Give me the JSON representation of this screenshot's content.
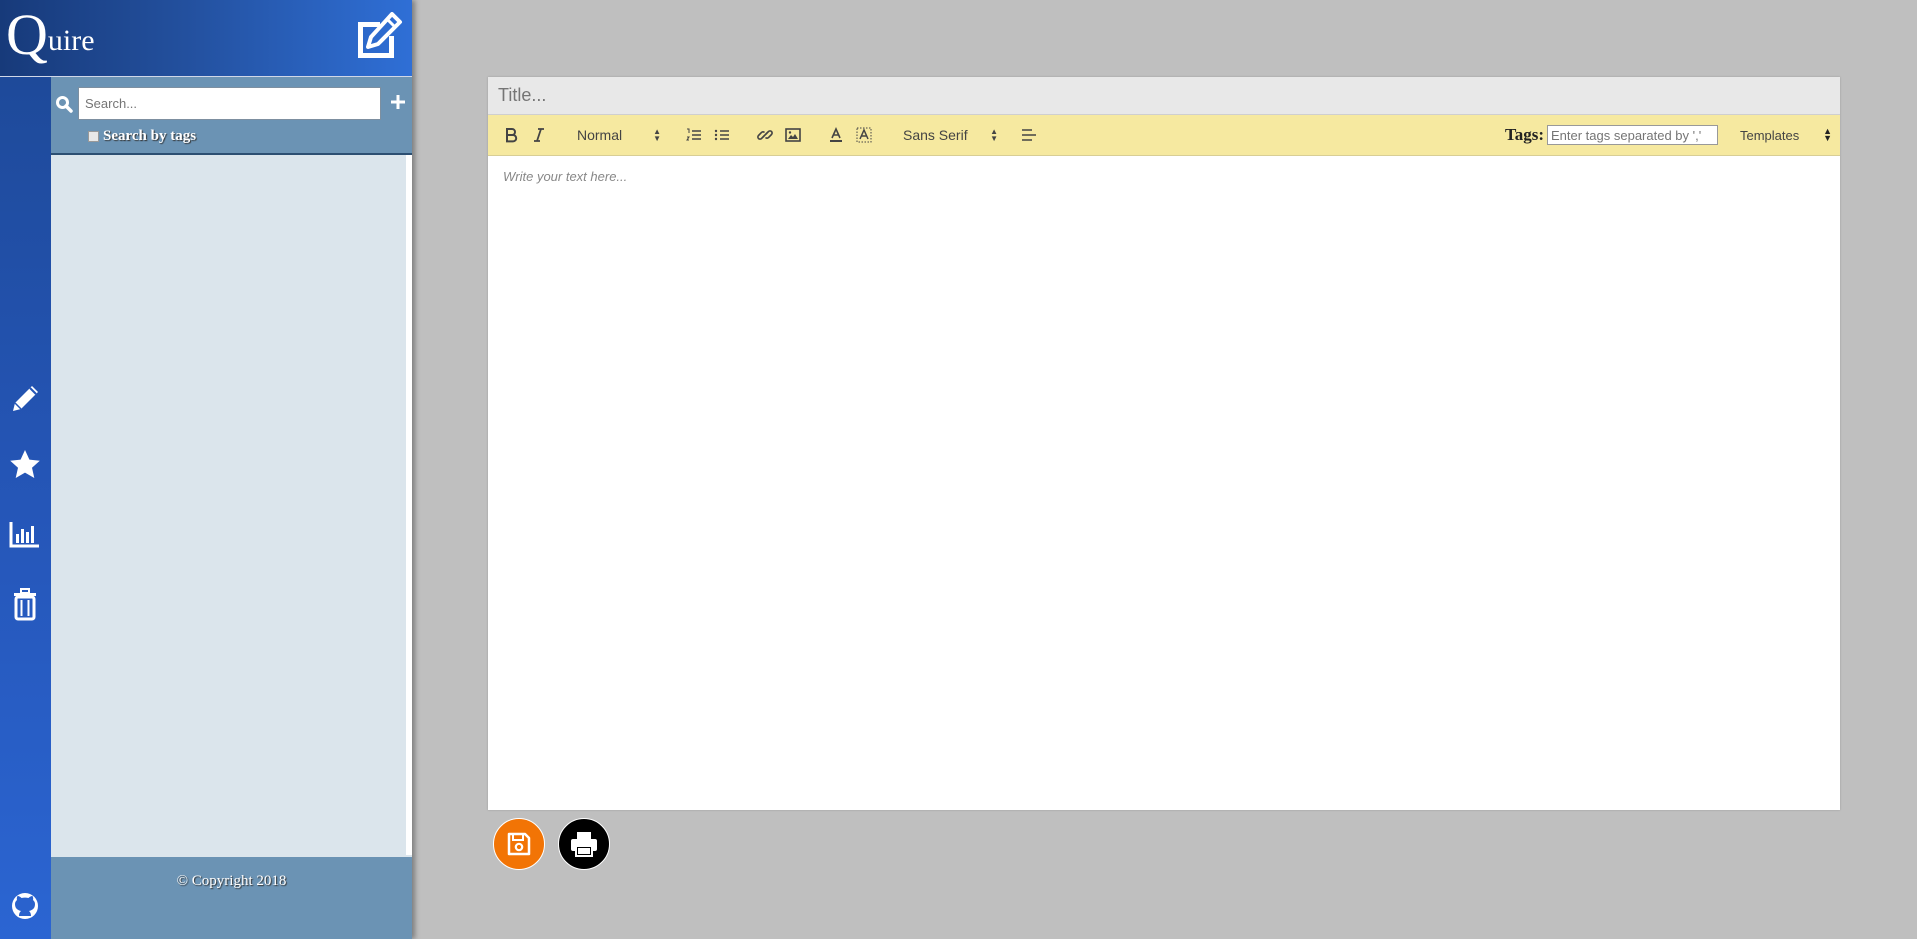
{
  "brand": {
    "logo_initial": "Q",
    "logo_rest": "uire"
  },
  "sidebar": {
    "search": {
      "placeholder": "Search..."
    },
    "search_by_tags_label": "Search by tags",
    "rail_icons": [
      "pencil-icon",
      "star-icon",
      "bar-chart-icon",
      "trash-icon",
      "github-icon"
    ],
    "footer_copyright": "© Copyright 2018"
  },
  "editor": {
    "title_placeholder": "Title...",
    "toolbar": {
      "header_select": "Normal",
      "font_select": "Sans Serif",
      "tags_label": "Tags:",
      "tags_placeholder": "Enter tags separated by ','",
      "templates_label": "Templates"
    },
    "body_placeholder": "Write your text here..."
  },
  "colors": {
    "save_button": "#f27405",
    "print_button": "#000000",
    "toolbar_bg": "#f6e9a0",
    "sidebar_accent": "#6b93b4"
  }
}
